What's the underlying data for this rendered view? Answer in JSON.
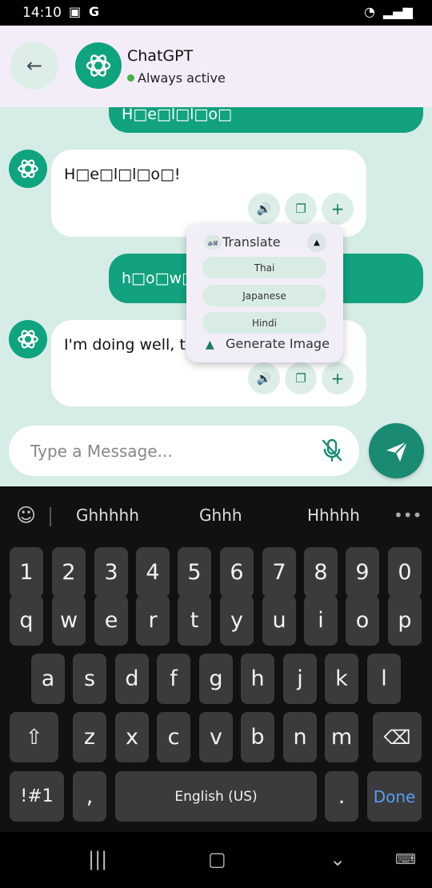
{
  "status_bar": {
    "time": "14:10",
    "carrier_glyph": "G"
  },
  "header": {
    "title": "ChatGPT",
    "status": "Always active"
  },
  "messages": [
    {
      "role": "user",
      "text": "H□e□l□l□o□"
    },
    {
      "role": "bot",
      "text": "H□e□l□l□o□!"
    },
    {
      "role": "user",
      "text": "h□o□w□"
    },
    {
      "role": "bot",
      "text": "I'm doing well, t"
    }
  ],
  "popup": {
    "translate_label": "Translate",
    "translate_icon_text": "aअ",
    "languages": [
      "Thai",
      "Japanese",
      "Hindi"
    ],
    "generate_label": "Generate Image"
  },
  "composer": {
    "placeholder": "Type a Message..."
  },
  "keyboard": {
    "suggestions": [
      "Ghhhhh",
      "Ghhh",
      "Hhhhh"
    ],
    "number_row": [
      "1",
      "2",
      "3",
      "4",
      "5",
      "6",
      "7",
      "8",
      "9",
      "0"
    ],
    "row1": [
      "q",
      "w",
      "e",
      "r",
      "t",
      "y",
      "u",
      "i",
      "o",
      "p"
    ],
    "row2": [
      "a",
      "s",
      "d",
      "f",
      "g",
      "h",
      "j",
      "k",
      "l"
    ],
    "row3": [
      "z",
      "x",
      "c",
      "v",
      "b",
      "n",
      "m"
    ],
    "symbols": "!#1",
    "comma": ",",
    "space": "English (US)",
    "period": ".",
    "done": "Done"
  },
  "colors": {
    "accent": "#12a27f",
    "chat_bg": "#d6ece7",
    "header_bg": "#f2edf8",
    "done": "#5a9cf0"
  },
  "icons": [
    "back-arrow-icon",
    "openai-logo-icon",
    "speaker-icon",
    "copy-icon",
    "plus-icon",
    "translate-icon",
    "chevron-up-icon",
    "image-icon",
    "mic-off-icon",
    "send-icon",
    "emoji-icon",
    "more-icon",
    "shift-icon",
    "backspace-icon",
    "recents-icon",
    "home-icon",
    "back-nav-icon",
    "keyboard-icon"
  ]
}
